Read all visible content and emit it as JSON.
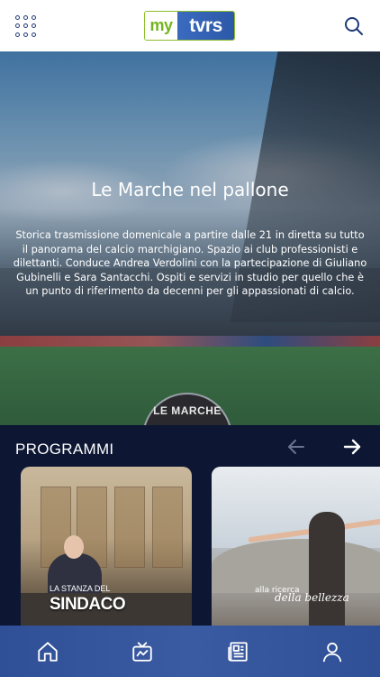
{
  "header": {
    "logo_my": "my",
    "logo_tvrs": "tvrs",
    "menu_icon": "grid-menu-icon",
    "search_icon": "search-icon"
  },
  "hero": {
    "title": "Le Marche nel pallone",
    "description": "Storica trasmissione domenicale a partire dalle 21 in diretta su tutto il panorama del calcio marchigiano. Spazio ai club professionisti e dilettanti. Conduce Andrea Verdolini con la partecipazione di Giuliano Gubinelli e Sara Santacchi. Ospiti e servizi in studio per quello che è un punto di riferimento da decenni per gli appassionati di calcio.",
    "badge_text": "LE MARCHE"
  },
  "programmi": {
    "title": "PROGRAMMI",
    "prev_icon": "arrow-left-icon",
    "next_icon": "arrow-right-icon",
    "cards": [
      {
        "line1": "LA STANZA DEL",
        "line2": "SINDACO"
      },
      {
        "line1": "alla ricerca",
        "line2": "della bellezza"
      }
    ]
  },
  "bottom_nav": {
    "items": [
      {
        "icon": "home-icon"
      },
      {
        "icon": "tv-icon"
      },
      {
        "icon": "news-icon"
      },
      {
        "icon": "user-icon"
      }
    ]
  },
  "colors": {
    "header_bg": "#ffffff",
    "brand_blue": "#2d58a8",
    "brand_green": "#73b51e",
    "section_bg": "#0d1733",
    "nav_bg": "#3a5aa2"
  }
}
